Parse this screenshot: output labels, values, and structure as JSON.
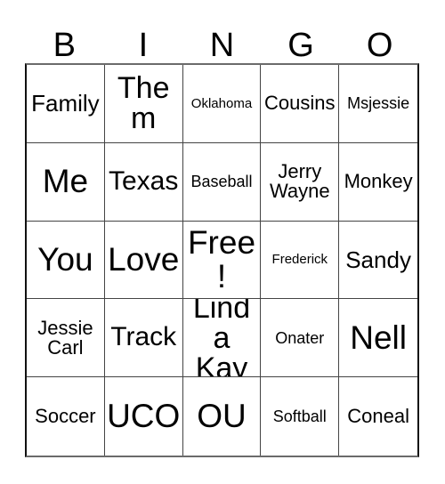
{
  "card": {
    "type": "bingo-card",
    "columns": 5,
    "rows": 5,
    "background_color": "#ffffff",
    "text_color": "#000000",
    "border_color": "#444444",
    "outer_border_color": "#111111"
  },
  "header": {
    "letters": [
      {
        "label": "B"
      },
      {
        "label": "I"
      },
      {
        "label": "N"
      },
      {
        "label": "G"
      },
      {
        "label": "O"
      }
    ]
  },
  "grid": {
    "cells": [
      {
        "text": "Family",
        "size": "fs-lg",
        "col": "B",
        "row": 1
      },
      {
        "text": "Them",
        "size": "fs-xxl",
        "col": "I",
        "row": 1
      },
      {
        "text": "Oklahoma",
        "size": "fs-xs",
        "col": "N",
        "row": 1
      },
      {
        "text": "Cousins",
        "size": "fs-md",
        "col": "G",
        "row": 1
      },
      {
        "text": "Msjessie",
        "size": "fs-sm",
        "col": "O",
        "row": 1
      },
      {
        "text": "Me",
        "size": "fs-huge",
        "col": "B",
        "row": 2
      },
      {
        "text": "Texas",
        "size": "fs-xl",
        "col": "I",
        "row": 2
      },
      {
        "text": "Baseball",
        "size": "fs-sm",
        "col": "N",
        "row": 2
      },
      {
        "text": "Jerry Wayne",
        "size": "fs-md",
        "col": "G",
        "row": 2,
        "lines": 2
      },
      {
        "text": "Monkey",
        "size": "fs-md",
        "col": "O",
        "row": 2
      },
      {
        "text": "You",
        "size": "fs-huge",
        "col": "B",
        "row": 3
      },
      {
        "text": "Love",
        "size": "fs-huge",
        "col": "I",
        "row": 3
      },
      {
        "text": "Free!",
        "size": "fs-huge",
        "col": "N",
        "row": 3,
        "free_space": true
      },
      {
        "text": "Frederick",
        "size": "fs-xs",
        "col": "G",
        "row": 3
      },
      {
        "text": "Sandy",
        "size": "fs-lg",
        "col": "O",
        "row": 3
      },
      {
        "text": "Jessie Carl",
        "size": "fs-md",
        "col": "B",
        "row": 4,
        "lines": 2
      },
      {
        "text": "Track",
        "size": "fs-xl",
        "col": "I",
        "row": 4
      },
      {
        "text": "Linda Kay",
        "size": "fs-xxl",
        "col": "N",
        "row": 4,
        "lines": 2
      },
      {
        "text": "Onater",
        "size": "fs-sm",
        "col": "G",
        "row": 4
      },
      {
        "text": "Nell",
        "size": "fs-huge",
        "col": "O",
        "row": 4
      },
      {
        "text": "Soccer",
        "size": "fs-md",
        "col": "B",
        "row": 5
      },
      {
        "text": "UCO",
        "size": "fs-huge",
        "col": "I",
        "row": 5
      },
      {
        "text": "OU",
        "size": "fs-huge",
        "col": "N",
        "row": 5
      },
      {
        "text": "Softball",
        "size": "fs-sm",
        "col": "G",
        "row": 5
      },
      {
        "text": "Coneal",
        "size": "fs-md",
        "col": "O",
        "row": 5
      }
    ]
  }
}
